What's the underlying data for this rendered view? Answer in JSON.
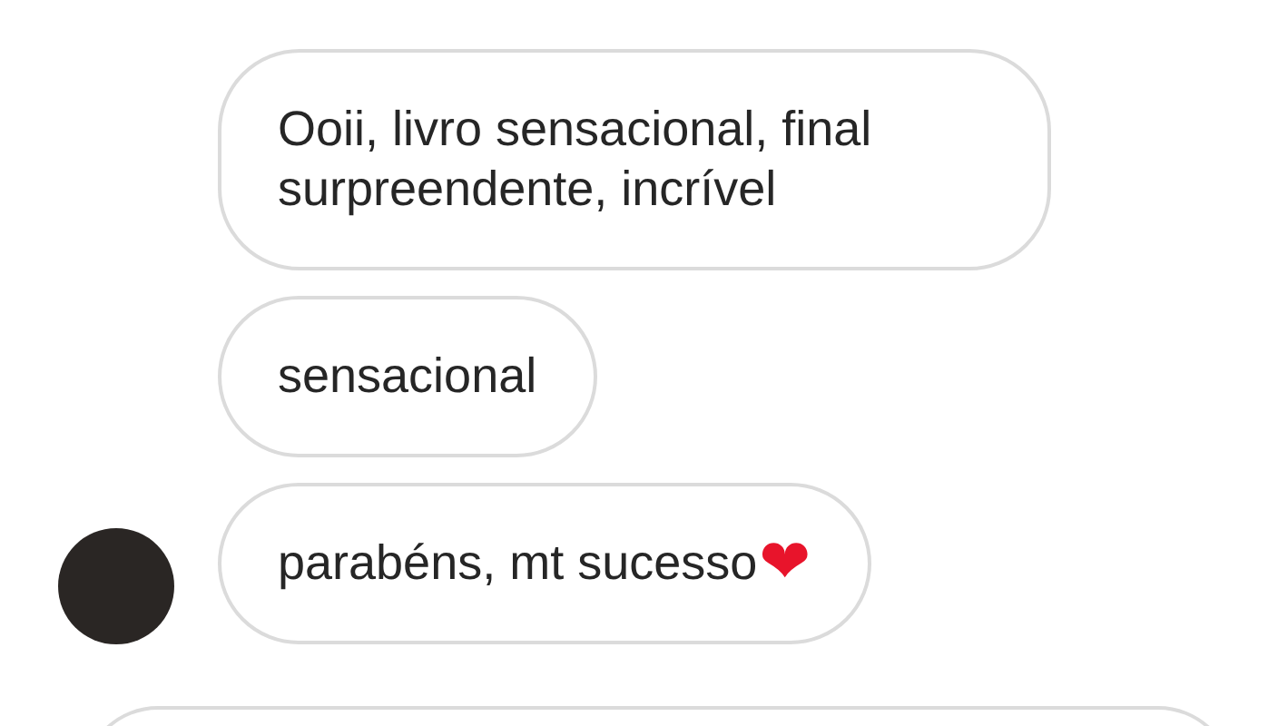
{
  "messages": [
    {
      "text": "Ooii, livro sensacional, final surpreendente, incrível",
      "avatar": false
    },
    {
      "text": "sensacional",
      "avatar": false
    },
    {
      "text": "parabéns, mt sucesso",
      "avatar": true,
      "emoji": "❤"
    }
  ]
}
